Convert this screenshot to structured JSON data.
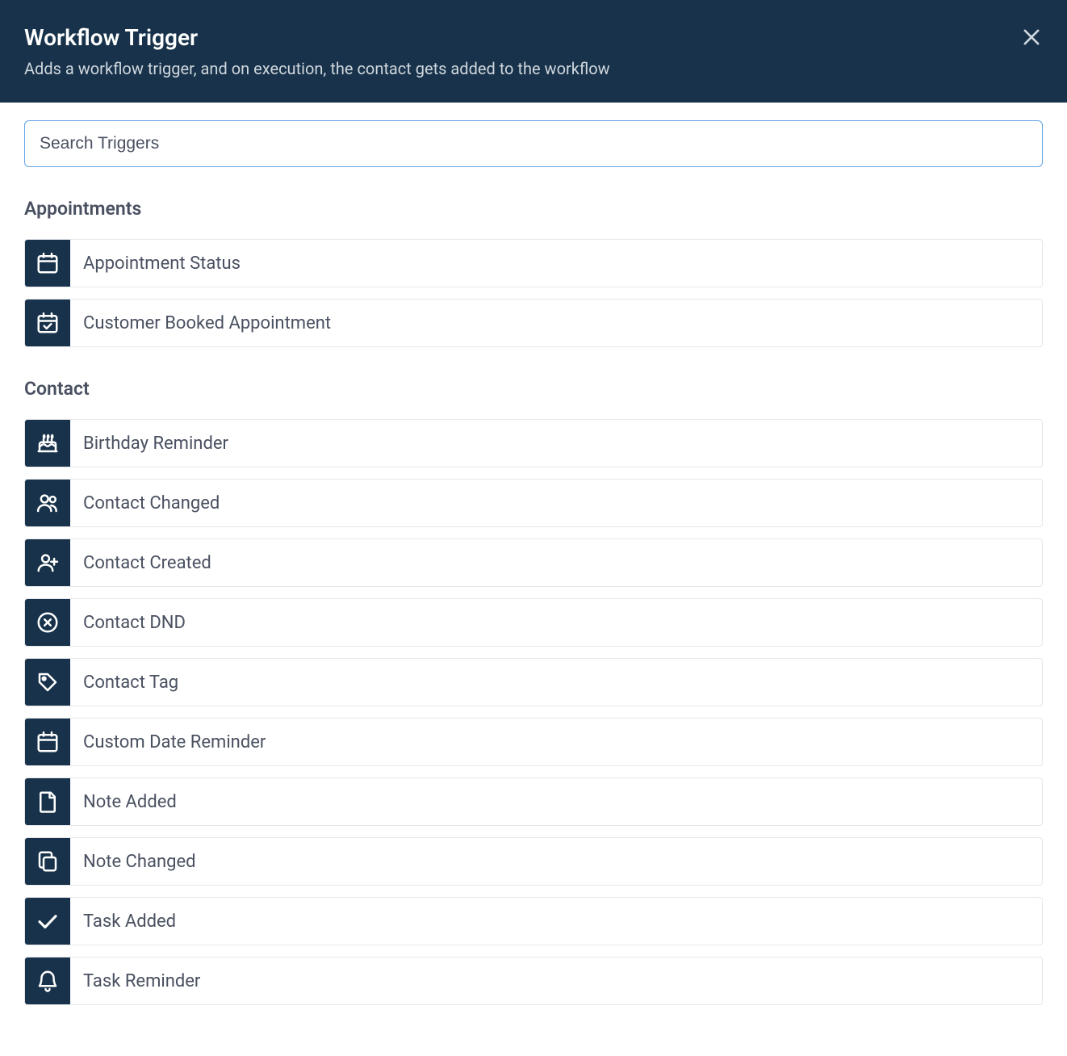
{
  "header": {
    "title": "Workflow Trigger",
    "subtitle": "Adds a workflow trigger, and on execution, the contact gets added to the workflow"
  },
  "search": {
    "placeholder": "Search Triggers",
    "value": ""
  },
  "groups": [
    {
      "title": "Appointments",
      "items": [
        {
          "label": "Appointment Status",
          "icon": "calendar-icon"
        },
        {
          "label": "Customer Booked Appointment",
          "icon": "calendar-check-icon"
        }
      ]
    },
    {
      "title": "Contact",
      "items": [
        {
          "label": "Birthday Reminder",
          "icon": "cake-icon"
        },
        {
          "label": "Contact Changed",
          "icon": "users-icon"
        },
        {
          "label": "Contact Created",
          "icon": "user-plus-icon"
        },
        {
          "label": "Contact DND",
          "icon": "circle-x-icon"
        },
        {
          "label": "Contact Tag",
          "icon": "tag-icon"
        },
        {
          "label": "Custom Date Reminder",
          "icon": "calendar-icon"
        },
        {
          "label": "Note Added",
          "icon": "file-icon"
        },
        {
          "label": "Note Changed",
          "icon": "copy-icon"
        },
        {
          "label": "Task Added",
          "icon": "check-icon"
        },
        {
          "label": "Task Reminder",
          "icon": "bell-icon"
        }
      ]
    }
  ]
}
